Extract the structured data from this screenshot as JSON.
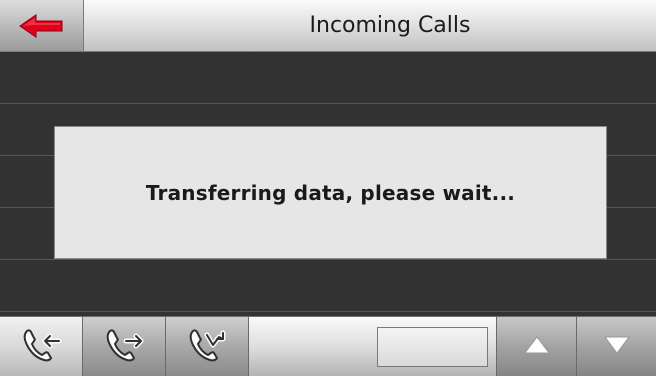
{
  "header": {
    "title": "Incoming Calls",
    "back_icon": "back-arrow-icon",
    "back_color": "#e0001a"
  },
  "dialog": {
    "message": "Transferring data, please wait..."
  },
  "toolbar": {
    "tabs": [
      {
        "icon": "phone-incoming-icon",
        "active": true
      },
      {
        "icon": "phone-outgoing-icon",
        "active": false
      },
      {
        "icon": "phone-missed-icon",
        "active": false
      }
    ],
    "page_indicator": "",
    "scroll_up_icon": "triangle-up-icon",
    "scroll_down_icon": "triangle-down-icon"
  }
}
